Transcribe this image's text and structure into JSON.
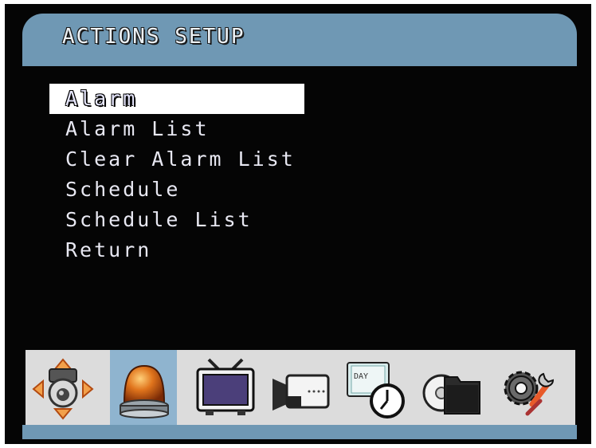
{
  "header": {
    "title": "ACTIONS SETUP"
  },
  "menu": {
    "items": [
      {
        "label": "Alarm"
      },
      {
        "label": "Alarm List"
      },
      {
        "label": "Clear Alarm List"
      },
      {
        "label": "Schedule"
      },
      {
        "label": "Schedule List"
      },
      {
        "label": "Return"
      }
    ],
    "selected": "Alarm"
  },
  "toolbar": {
    "icons": [
      {
        "name": "ptz-camera-icon"
      },
      {
        "name": "alarm-beacon-icon",
        "active": true
      },
      {
        "name": "monitor-tv-icon"
      },
      {
        "name": "camera-icon"
      },
      {
        "name": "schedule-clock-icon",
        "label": "DAY"
      },
      {
        "name": "disk-folder-icon"
      },
      {
        "name": "system-settings-icon"
      }
    ]
  },
  "colors": {
    "accent": "#6f98b4",
    "active_tile": "#8fb4cf",
    "background": "#050505",
    "icon_bar": "#dcdcdc"
  }
}
